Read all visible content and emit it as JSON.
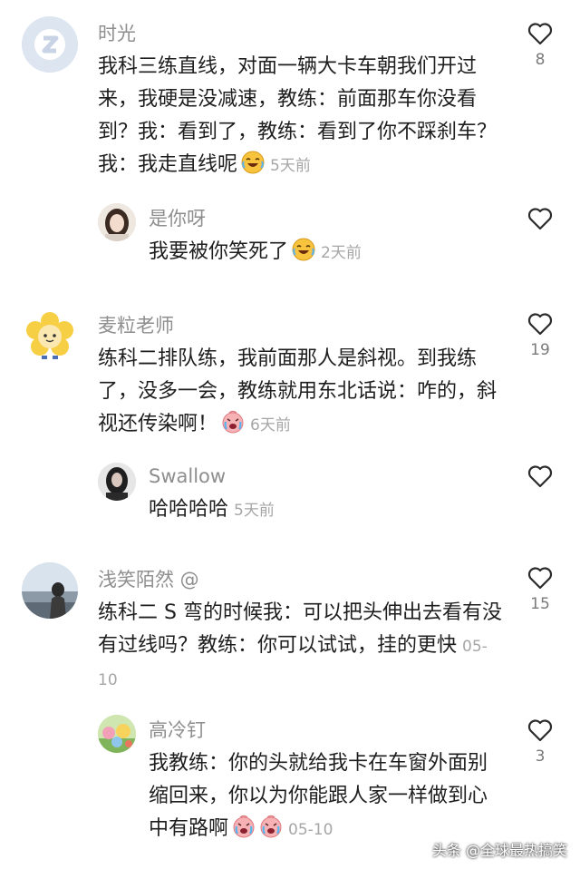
{
  "comments": [
    {
      "username": "时光",
      "text": "我科三练直线，对面一辆大卡车朝我们开过来，我硬是没减速，教练：前面那车你没看到？我：看到了，教练：看到了你不踩刹车？我：我走直线呢",
      "emoji": "laugh-cry-emoji",
      "time": "5天前",
      "likes": "8",
      "avatar": "z-logo-avatar",
      "reply": {
        "username": "是你呀",
        "text": "我要被你笑死了",
        "emoji": "laugh-cry-emoji",
        "time": "2天前",
        "likes": "",
        "avatar": "girl-photo-avatar"
      }
    },
    {
      "username": "麦粒老师",
      "text": "练科二排队练，我前面那人是斜视。到我练了，没多一会，教练就用东北话说：咋的，斜视还传染啊！",
      "emoji": "crying-emoji",
      "time": "6天前",
      "likes": "19",
      "avatar": "flower-cartoon-avatar",
      "reply": {
        "username": "Swallow",
        "text": "哈哈哈哈",
        "emoji": "",
        "time": "5天前",
        "likes": "",
        "avatar": "dark-portrait-avatar"
      }
    },
    {
      "username": "浅笑陌然 @",
      "text": "练科二 S 弯的时候我：可以把头伸出去看有没有过线吗？教练：你可以试试，挂的更快",
      "emoji": "",
      "time": "05-10",
      "likes": "15",
      "avatar": "beach-photo-avatar",
      "reply": {
        "username": "高冷钉",
        "text": "我教练：你的头就给我卡在车窗外面别缩回来，你以为你能跟人家一样做到心中有路啊",
        "emoji": "crying-emoji",
        "time": "05-10",
        "likes": "3",
        "avatar": "colorful-cartoon-avatar"
      }
    }
  ],
  "watermark": "头条 @全球最热搞笑",
  "colors": {
    "text": "#1e1e1e",
    "username": "#8e8e8e",
    "time": "#a6a6a6",
    "icon": "#2b2b2b"
  }
}
